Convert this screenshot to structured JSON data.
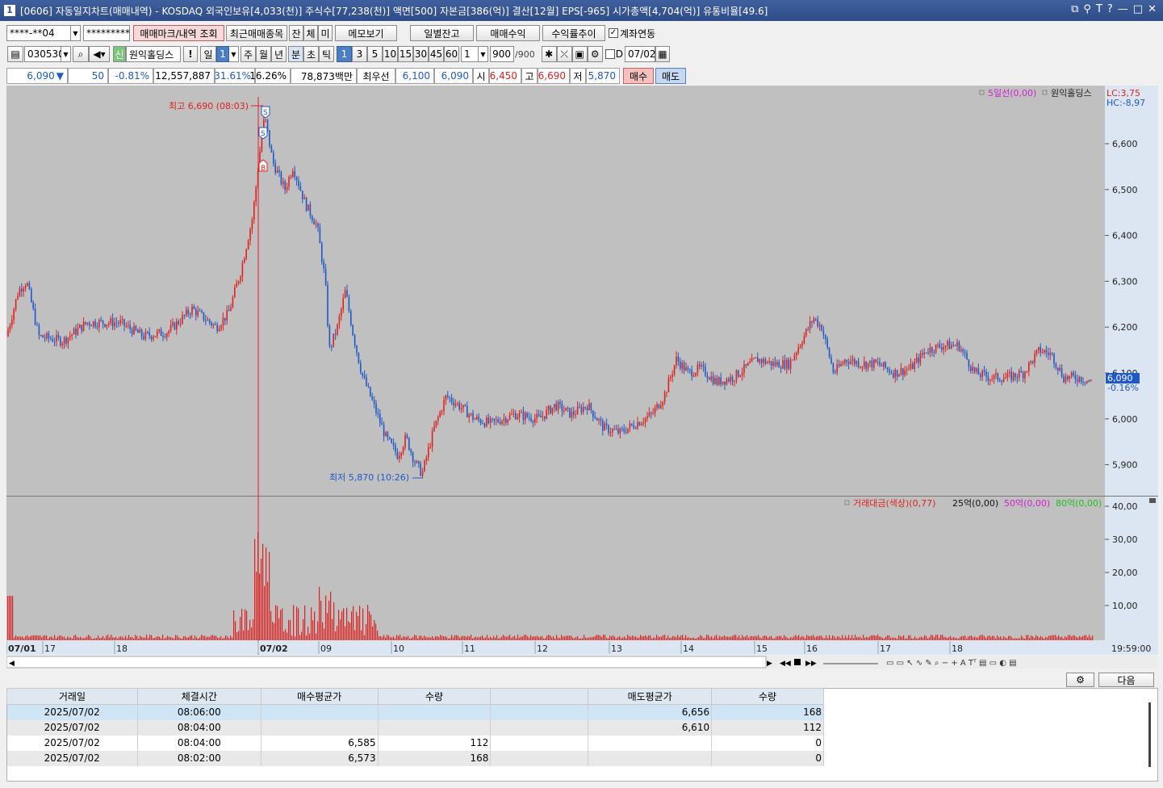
{
  "window": {
    "title": "[0606] 자동일지차트(매매내역) - KOSDAQ 외국인보유[4,033(천)] 주식수[77,238(천)] 액면[500] 자본금[386(억)] 결산[12월] EPS[-965] 시가총액[4,704(억)] 유통비율[49.6]",
    "icon": "1"
  },
  "toolbar1": {
    "account": "****-**04",
    "password": "*********",
    "mark_btn": "매매마크/내역 조회",
    "recent_btn": "최근매매종목",
    "tab_jan": "잔",
    "tab_che": "체",
    "tab_mi": "미",
    "memo_btn": "메모보기",
    "daily_btn": "일별잔고",
    "profit_btn": "매매수익",
    "rate_btn": "수익률추이",
    "account_link_label": "계좌연동"
  },
  "toolbar2": {
    "code": "030530",
    "shin": "신",
    "stock_name": "원익홀딩스",
    "excl": "!",
    "period_day": "일",
    "period_num": "1",
    "week": "주",
    "month": "월",
    "year": "년",
    "minute": "분",
    "second": "초",
    "tick": "틱",
    "intervals": [
      "1",
      "3",
      "5",
      "10",
      "15",
      "30",
      "45",
      "60"
    ],
    "unit": "1",
    "count": "900",
    "count_total": "/900",
    "d_label": "D",
    "date": "07/02"
  },
  "quote": {
    "price": "6,090",
    "arrow": "▼",
    "change": "50",
    "change_pct": "-0.81%",
    "volume": "12,557,887",
    "pct1": "31.61%",
    "pct2": "16.26%",
    "amount": "78,873백만",
    "best_label": "최우선",
    "ask": "6,100",
    "bid": "6,090",
    "open_label": "시",
    "open": "6,450",
    "high_label": "고",
    "high": "6,690",
    "low_label": "저",
    "low": "5,870",
    "buy_btn": "매수",
    "sell_btn": "매도"
  },
  "chart": {
    "legend_ma": "5일선(0,00)",
    "legend_name": "원익홀딩스",
    "lc": "LC:3,75",
    "hc": "HC:-8,97",
    "high_marker": "최고 6,690 (08:03)",
    "low_marker": "최저 5,870 (10:26)",
    "current_tag": "6,090",
    "current_pct": "-0.16%",
    "y_ticks": [
      "6,600",
      "6,500",
      "6,400",
      "6,300",
      "6,200",
      "6,100",
      "6,000",
      "5,900"
    ],
    "vol_legend_1": "거래대금(색상)(0,77)",
    "vol_legend_2": "25억(0,00)",
    "vol_legend_3": "50억(0,00)",
    "vol_legend_4": "80억(0,00)",
    "vol_ticks": [
      "40,00",
      "30,00",
      "20,00",
      "10,00"
    ],
    "x_labels": [
      "07/01",
      "17",
      "18",
      "07/02",
      "09",
      "10",
      "11",
      "12",
      "13",
      "14",
      "15",
      "16",
      "17",
      "18"
    ],
    "x_right": "19:59:00",
    "colors": {
      "up": "#e0201e",
      "down": "#1f58c8",
      "bg": "#c0c0c0",
      "axis": "#dbe6f2"
    }
  },
  "bottom": {
    "next_btn": "다음",
    "columns": [
      "거래일",
      "체결시간",
      "매수평균가",
      "수량",
      "",
      "매도평균가",
      "수량"
    ],
    "rows": [
      [
        "2025/07/02",
        "08:06:00",
        "",
        "",
        "",
        "6,656",
        "168"
      ],
      [
        "2025/07/02",
        "08:04:00",
        "",
        "",
        "",
        "6,610",
        "112"
      ],
      [
        "2025/07/02",
        "08:04:00",
        "6,585",
        "112",
        "",
        "",
        "0"
      ],
      [
        "2025/07/02",
        "08:02:00",
        "6,573",
        "168",
        "",
        "",
        "0"
      ]
    ]
  }
}
